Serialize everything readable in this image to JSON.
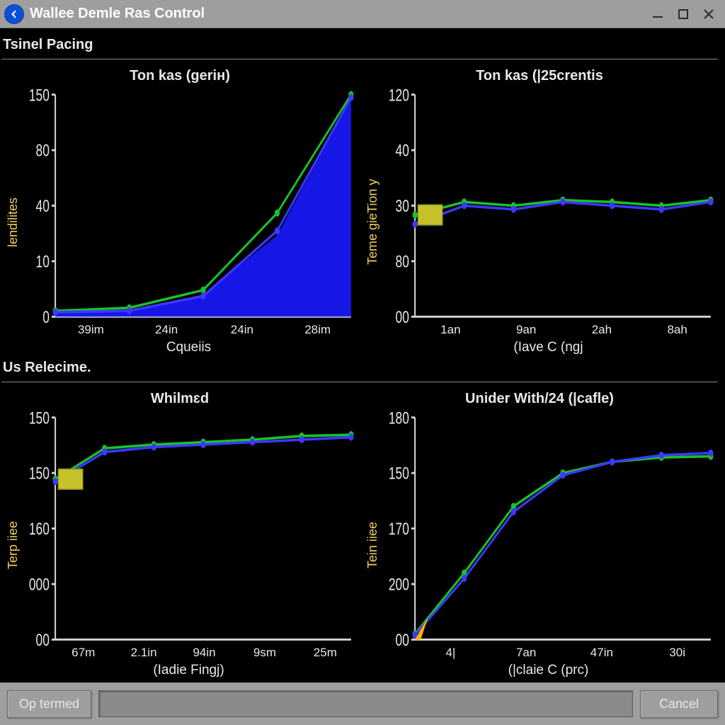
{
  "window": {
    "title": "Wallee Demle Ras Control",
    "back_label": "Back",
    "min_label": "Minimize",
    "max_label": "Maximize",
    "close_label": "Close"
  },
  "sections": {
    "top_label": "Tsinel Pacing",
    "bottom_label": "Us Relecime."
  },
  "footer": {
    "op_label": "Op termed",
    "cancel_label": "Cancel",
    "status_value": ""
  },
  "chart_data": [
    {
      "id": "chart_tl",
      "type": "area",
      "title": "Ton kas (geriн)",
      "xlabel": "Cqueiis",
      "ylabel": "lendilites",
      "categories": [
        "39im",
        "24in",
        "24in",
        "28im"
      ],
      "y_ticks": [
        0,
        10,
        40,
        80,
        150
      ],
      "ylim": [
        0,
        150
      ],
      "series": [
        {
          "name": "area",
          "style": "area",
          "values": [
            2,
            4,
            15,
            55,
            148
          ]
        },
        {
          "name": "green",
          "style": "green",
          "values": [
            4,
            6,
            18,
            70,
            150
          ]
        },
        {
          "name": "blue",
          "style": "blue",
          "values": [
            3,
            4,
            14,
            58,
            148
          ]
        }
      ]
    },
    {
      "id": "chart_tr",
      "type": "line",
      "title": "Ton kas (|25crentis",
      "xlabel": "(Iave C (ngj",
      "ylabel": "Teme gieTion y",
      "categories": [
        "1an",
        "9an",
        "2ah",
        "8ah"
      ],
      "y_ticks": [
        "00",
        80,
        30,
        40,
        120
      ],
      "ylim": [
        0,
        120
      ],
      "legend": true,
      "series": [
        {
          "name": "green",
          "style": "green",
          "values": [
            55,
            62,
            60,
            63,
            62,
            60,
            63
          ]
        },
        {
          "name": "blue",
          "style": "blue",
          "values": [
            50,
            60,
            58,
            62,
            60,
            58,
            62
          ]
        }
      ]
    },
    {
      "id": "chart_bl",
      "type": "line",
      "title": "Whilmɛd",
      "xlabel": "(Iadie Fingj)",
      "ylabel": "Terp iiee",
      "categories": [
        "67m",
        "2.1in",
        "94in",
        "9sm",
        "25m"
      ],
      "y_ticks": [
        "00",
        "000",
        160,
        150,
        150
      ],
      "ylim": [
        0,
        180
      ],
      "legend": true,
      "series": [
        {
          "name": "green",
          "style": "green",
          "values": [
            130,
            155,
            158,
            160,
            162,
            165,
            166
          ]
        },
        {
          "name": "blue",
          "style": "blue",
          "values": [
            128,
            152,
            156,
            158,
            160,
            162,
            164
          ]
        }
      ]
    },
    {
      "id": "chart_br",
      "type": "line",
      "title": "Unider With/24 (|cafle)",
      "xlabel": "(|claie C (prс)",
      "ylabel": "Tein iiee",
      "categories": [
        "4|",
        "7an",
        "47in",
        "30i"
      ],
      "y_ticks": [
        "00",
        200,
        170,
        150,
        180
      ],
      "ylim": [
        0,
        200
      ],
      "series": [
        {
          "name": "green",
          "style": "green",
          "values": [
            5,
            60,
            120,
            150,
            160,
            164,
            165
          ]
        },
        {
          "name": "blue",
          "style": "blue",
          "values": [
            4,
            55,
            115,
            148,
            160,
            166,
            168
          ]
        }
      ],
      "origin_marker": true
    }
  ]
}
